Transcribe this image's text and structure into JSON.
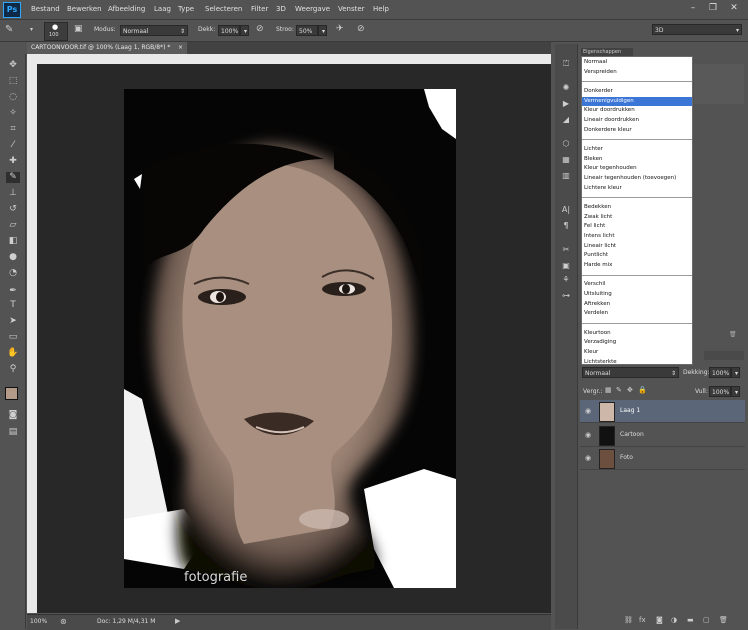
{
  "app": {
    "logo": "Ps"
  },
  "menu": [
    "Bestand",
    "Bewerken",
    "Afbeelding",
    "Laag",
    "Type",
    "Selecteren",
    "Filter",
    "3D",
    "Weergave",
    "Venster",
    "Help"
  ],
  "options": {
    "brush_size": "100",
    "mode_label": "Modus:",
    "mode_value": "Normaal",
    "opacity_label": "Dekk:",
    "opacity_value": "100%",
    "flow_label": "Stroo:",
    "flow_value": "50%",
    "workspace": "3D"
  },
  "document": {
    "tab_title": "CARTOONVOOR.tif @ 100% (Laag 1, RGB/8*) *",
    "zoom": "100%",
    "doc_info": "Doc: 1,29 M/4,31 M",
    "signature": "fotografie"
  },
  "blend_modes": {
    "groups": [
      [
        "Normaal",
        "Verspreiden"
      ],
      [
        "Donkerder",
        "Vermenigvuldigen",
        "Kleur doordrukken",
        "Lineair doordrukken",
        "Donkerdere kleur"
      ],
      [
        "Lichter",
        "Bleken",
        "Kleur tegenhouden",
        "Lineair tegenhouden (toevoegen)",
        "Lichtere kleur"
      ],
      [
        "Bedekken",
        "Zwak licht",
        "Fel licht",
        "Intens licht",
        "Lineair licht",
        "Puntlicht",
        "Harde mix"
      ],
      [
        "Verschil",
        "Uitsluiting",
        "Aftrekken",
        "Verdelen"
      ],
      [
        "Kleurtoon",
        "Verzadiging",
        "Kleur",
        "Lichtsterkte"
      ]
    ],
    "selected": "Vermenigvuldigen",
    "panel_tab": "Eigenschappen"
  },
  "layers_panel": {
    "blend_value": "Normaal",
    "opacity_label": "Dekking:",
    "opacity_value": "100%",
    "lock_label": "Vergr.:",
    "fill_label": "Vull:",
    "fill_value": "100%",
    "layers": [
      {
        "name": "Laag 1",
        "selected": true
      },
      {
        "name": "Cartoon",
        "selected": false
      },
      {
        "name": "Foto",
        "selected": false
      }
    ]
  },
  "colors": {
    "accent": "#3b76d6",
    "selected_layer": "#5b6779",
    "foreground": "#b39a89",
    "background": "#ffffff"
  },
  "icons": {
    "tools": [
      "move-tool-icon",
      "marquee-tool-icon",
      "lasso-tool-icon",
      "quick-select-icon",
      "crop-tool-icon",
      "eyedropper-icon",
      "healing-brush-icon",
      "brush-tool-icon",
      "clone-stamp-icon",
      "history-brush-icon",
      "eraser-icon",
      "gradient-tool-icon",
      "blur-tool-icon",
      "dodge-tool-icon",
      "pen-tool-icon",
      "type-tool-icon",
      "path-select-icon",
      "shape-tool-icon",
      "hand-tool-icon",
      "zoom-tool-icon"
    ]
  }
}
